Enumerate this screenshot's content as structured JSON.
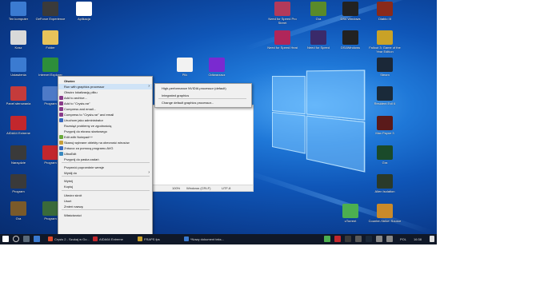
{
  "desktop": {
    "left_icons": [
      {
        "label": "Ten komputer",
        "color": "#3b7bd1"
      },
      {
        "label": "GeForce Experience",
        "color": "#3a3a3a"
      },
      {
        "label": "Aplikacja",
        "color": "#ffffff"
      },
      {
        "label": "Kosz",
        "color": "#d9d9d9"
      },
      {
        "label": "Folder",
        "color": "#e8c35a"
      },
      {
        "label": "Ustawienia",
        "color": "#3b7bd1"
      },
      {
        "label": "Internet Explorer",
        "color": "#2d8f3a"
      },
      {
        "label": "Panel sterowania",
        "color": "#c43b3b"
      },
      {
        "label": "Program",
        "color": "#4e7ac7"
      },
      {
        "label": "AIDA64 Extreme",
        "color": "#c2272d"
      },
      {
        "label": "Narzędzie",
        "color": "#3a3a3a"
      },
      {
        "label": "Program",
        "color": "#c2272d"
      },
      {
        "label": "Program",
        "color": "#3a3a3a"
      },
      {
        "label": "Gra",
        "color": "#7a5a2a"
      },
      {
        "label": "Program",
        "color": "#3a6a3a"
      }
    ],
    "right_icons": [
      {
        "label": "Need for Speed Pro Street",
        "color": "#b33a5a"
      },
      {
        "label": "Gra",
        "color": "#5a8a2a"
      },
      {
        "label": "DS4 Windows",
        "color": "#222222"
      },
      {
        "label": "Diablo III",
        "color": "#8a2a1a"
      },
      {
        "label": "Need for Speed Heat",
        "color": "#b0265a"
      },
      {
        "label": "Need for Speed",
        "color": "#3a2a6a"
      },
      {
        "label": "DS4Windows",
        "color": "#222222"
      },
      {
        "label": "Fallout 3: Game of the Year Edition",
        "color": "#c9a227"
      },
      {
        "label": "Plik",
        "color": "#f2f2f2"
      },
      {
        "label": "Odtwarzacz",
        "color": "#7a2ad0"
      },
      {
        "label": "Steam",
        "color": "#1b2838"
      },
      {
        "label": "Resident Evil 6",
        "color": "#1a2a3a"
      },
      {
        "label": "Max Payne 3",
        "color": "#5a1a1a"
      },
      {
        "label": "Gra",
        "color": "#1a4a2a"
      },
      {
        "label": "Alien Isolation",
        "color": "#2a3a2a"
      },
      {
        "label": "uTorrent",
        "color": "#4caf50"
      },
      {
        "label": "Counter-Strike: Source",
        "color": "#c98a2a"
      }
    ]
  },
  "context_menu": {
    "items": [
      {
        "label": "Otwórz",
        "bold": true
      },
      {
        "label": "Run with graphics processor",
        "submenu": true,
        "highlight": true
      },
      {
        "label": "Otwórz lokalizację pliku"
      },
      {
        "label": "Add to archive...",
        "icon": "#8a3a8a"
      },
      {
        "label": "Add to \"Crysis.rar\"",
        "icon": "#8a3a8a"
      },
      {
        "label": "Compress and email...",
        "icon": "#8a3a8a"
      },
      {
        "label": "Compress to \"Crysis.rar\" and email",
        "icon": "#8a3a8a"
      },
      {
        "label": "Uruchom jako administrator",
        "icon": "#3a6ac0"
      },
      {
        "label": "Rozwiąż problemy ze zgodnością"
      },
      {
        "label": "Przypnij do ekranu startowego"
      },
      {
        "label": "Edit with Notepad++",
        "icon": "#6aaa3a"
      },
      {
        "label": "Skanuj wybrane obiekty na obecność wirusów",
        "icon": "#c8a03a"
      },
      {
        "label": "Zniszcz za pomocą programu AVG",
        "icon": "#3a6ac0"
      },
      {
        "label": "UltraEdit",
        "icon": "#3a8ac0"
      },
      {
        "label": "Przypnij do paska zadań"
      },
      {
        "label": "Przywróć poprzednie wersje"
      },
      {
        "label": "Wyślij do",
        "submenu": true
      },
      {
        "label": "Wytnij"
      },
      {
        "label": "Kopiuj"
      },
      {
        "label": "Utwórz skrót"
      },
      {
        "label": "Usuń"
      },
      {
        "label": "Zmień nazwę"
      },
      {
        "label": "Właściwości"
      }
    ]
  },
  "submenu": {
    "items": [
      {
        "label": "High-performance NVIDIA processor (default)"
      },
      {
        "label": "Integrated graphics"
      },
      {
        "label": "Change default graphics processor..."
      }
    ]
  },
  "notepad": {
    "zoom": "100%",
    "line_ending": "Windows (CRLF)",
    "encoding": "UTF-8"
  },
  "taskbar": {
    "tasks": [
      {
        "label": "Crysis 2 - Szukaj w Go...",
        "color": "#e04a2a"
      },
      {
        "label": "AIDA64 Extreme",
        "color": "#c2272d"
      },
      {
        "label": "FRAPS fps",
        "color": "#c8a02a"
      },
      {
        "label": "*Nowy dokument teks...",
        "color": "#3a7ad0"
      }
    ],
    "language": "POL",
    "time": "16:38"
  }
}
